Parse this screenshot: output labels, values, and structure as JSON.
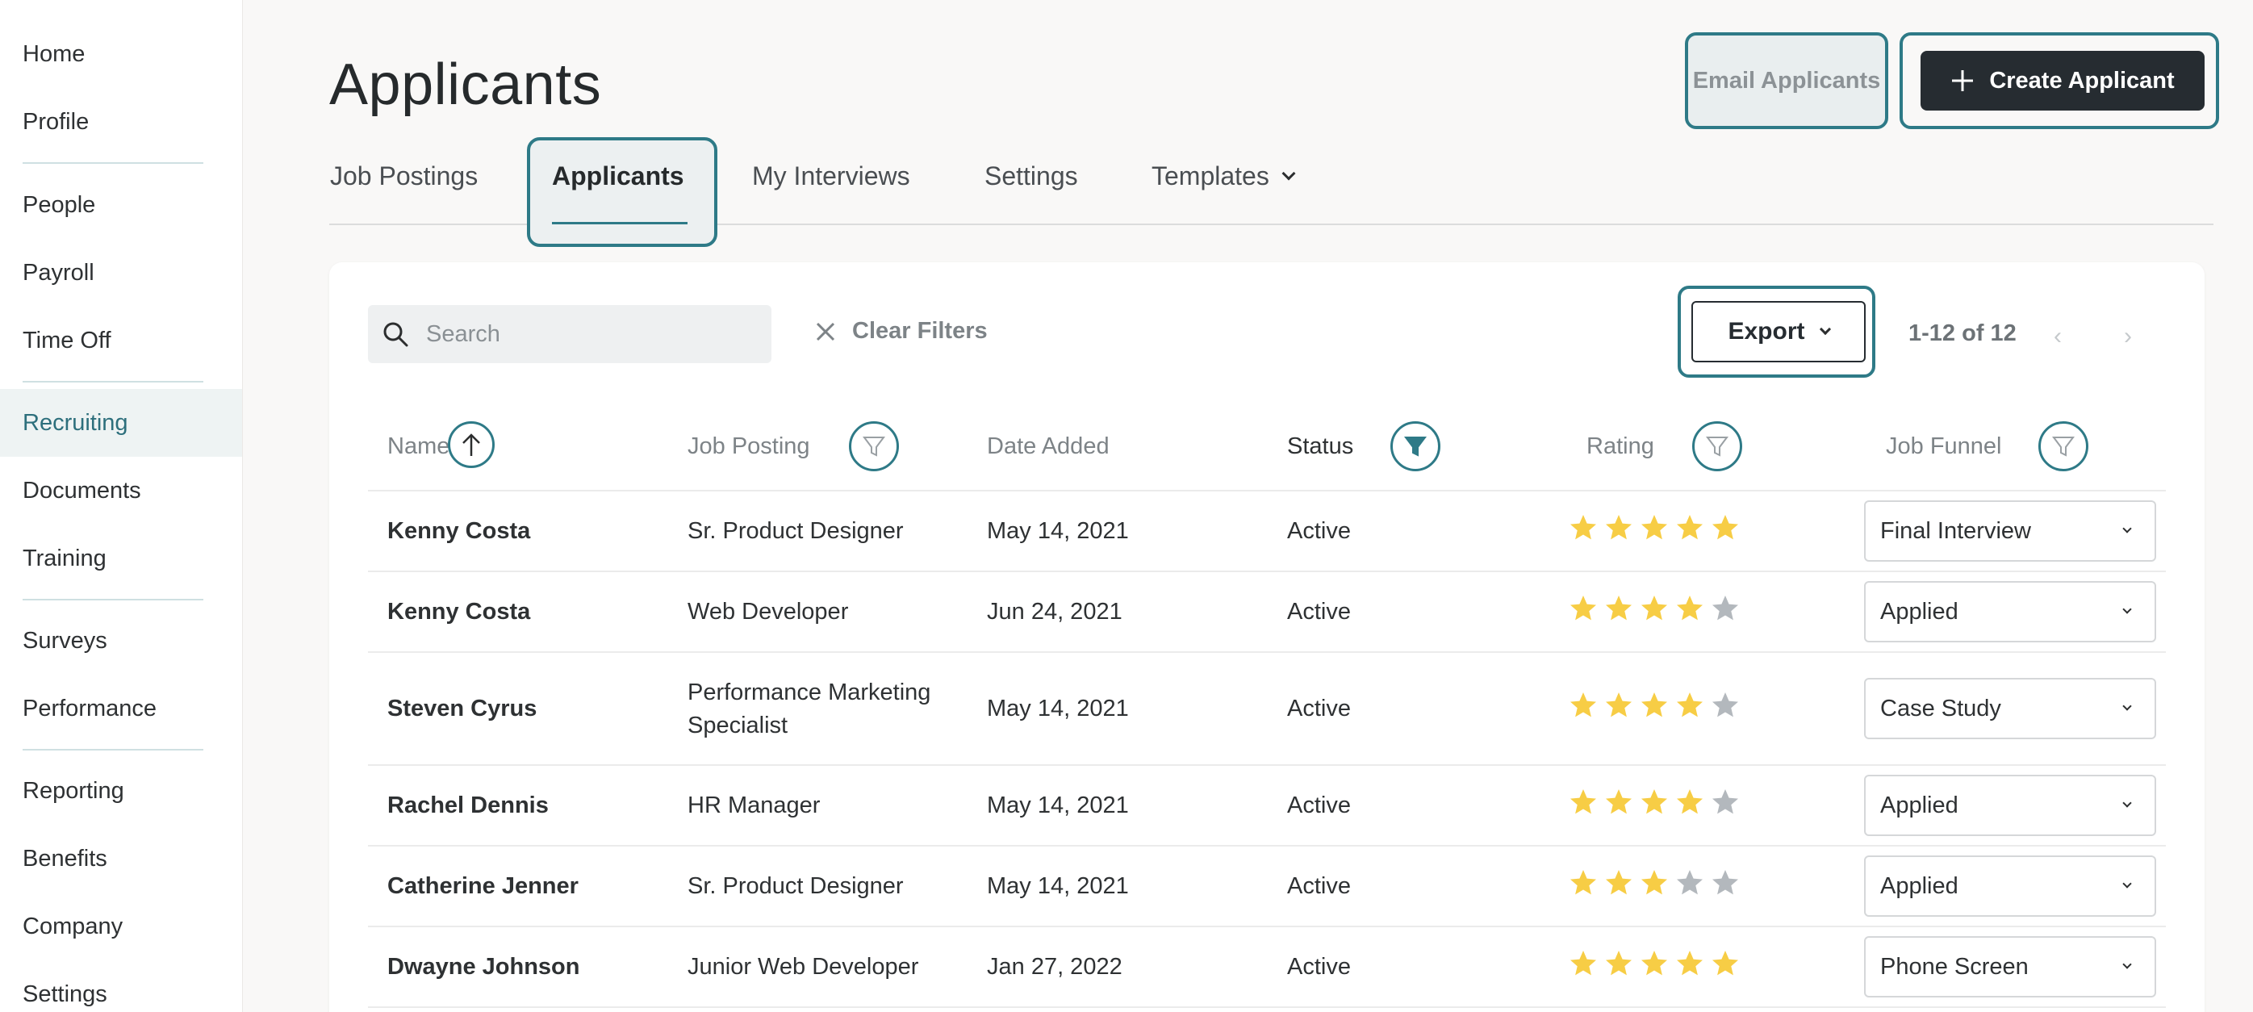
{
  "sidebar": {
    "items": [
      {
        "label": "Home"
      },
      {
        "label": "Profile"
      },
      {
        "label": "People"
      },
      {
        "label": "Payroll"
      },
      {
        "label": "Time Off"
      },
      {
        "label": "Recruiting"
      },
      {
        "label": "Documents"
      },
      {
        "label": "Training"
      },
      {
        "label": "Surveys"
      },
      {
        "label": "Performance"
      },
      {
        "label": "Reporting"
      },
      {
        "label": "Benefits"
      },
      {
        "label": "Company"
      },
      {
        "label": "Settings"
      }
    ],
    "active": "Recruiting"
  },
  "header": {
    "title": "Applicants",
    "email_label": "Email Applicants",
    "create_label": "Create Applicant"
  },
  "tabs": [
    {
      "label": "Job Postings"
    },
    {
      "label": "Applicants"
    },
    {
      "label": "My Interviews"
    },
    {
      "label": "Settings"
    },
    {
      "label": "Templates"
    }
  ],
  "toolbar": {
    "search_placeholder": "Search",
    "clear_filters": "Clear Filters",
    "export_label": "Export",
    "pagination": "1-12 of 12",
    "prev_arrow": "‹",
    "next_arrow": "›"
  },
  "table": {
    "columns": [
      "Name",
      "Job Posting",
      "Date Added",
      "Status",
      "Rating",
      "Job Funnel"
    ],
    "rows": [
      {
        "name": "Kenny Costa",
        "job": "Sr. Product Designer",
        "date": "May 14, 2021",
        "status": "Active",
        "rating": 5,
        "funnel": "Final Interview"
      },
      {
        "name": "Kenny Costa",
        "job": "Web Developer",
        "date": "Jun 24, 2021",
        "status": "Active",
        "rating": 4,
        "funnel": "Applied"
      },
      {
        "name": "Steven Cyrus",
        "job": "Performance Marketing Specialist",
        "date": "May 14, 2021",
        "status": "Active",
        "rating": 4,
        "funnel": "Case Study"
      },
      {
        "name": "Rachel Dennis",
        "job": "HR Manager",
        "date": "May 14, 2021",
        "status": "Active",
        "rating": 4,
        "funnel": "Applied"
      },
      {
        "name": "Catherine Jenner",
        "job": "Sr. Product Designer",
        "date": "May 14, 2021",
        "status": "Active",
        "rating": 3,
        "funnel": "Applied"
      },
      {
        "name": "Dwayne Johnson",
        "job": "Junior Web Developer",
        "date": "Jan 27, 2022",
        "status": "Active",
        "rating": 5,
        "funnel": "Phone Screen"
      }
    ]
  },
  "colors": {
    "accent": "#2e7a87",
    "star_filled": "#f7cd45",
    "star_empty": "#b3b8bd",
    "button_dark": "#262c31"
  }
}
